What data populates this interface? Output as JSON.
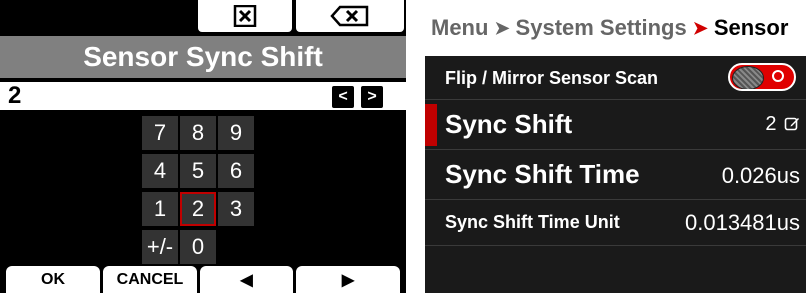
{
  "keyboard": {
    "title": "Sensor Sync Shift",
    "value": "2",
    "prev_label": "<",
    "next_label": ">",
    "keys": {
      "k7": "7",
      "k8": "8",
      "k9": "9",
      "k4": "4",
      "k5": "5",
      "k6": "6",
      "k1": "1",
      "k2": "2",
      "k3": "3",
      "kpm": "+/-",
      "k0": "0"
    },
    "selected_key": "2",
    "softkeys": {
      "ok": "OK",
      "cancel": "CANCEL",
      "left": "◀",
      "right": "▶"
    }
  },
  "settings": {
    "breadcrumb": {
      "menu": "Menu",
      "system": "System Settings",
      "sensor": "Sensor"
    },
    "rows": {
      "flip": {
        "label": "Flip / Mirror Sensor Scan",
        "toggle_on": true
      },
      "sync_shift": {
        "label": "Sync Shift",
        "value": "2"
      },
      "sync_shift_time": {
        "label": "Sync Shift Time",
        "value": "0.026us"
      },
      "sync_shift_time_unit": {
        "label": "Sync Shift Time Unit",
        "value": "0.013481us"
      }
    }
  },
  "colors": {
    "accent_red": "#c00000",
    "title_gray": "#808080",
    "panel_dark": "#1a1a1a"
  }
}
